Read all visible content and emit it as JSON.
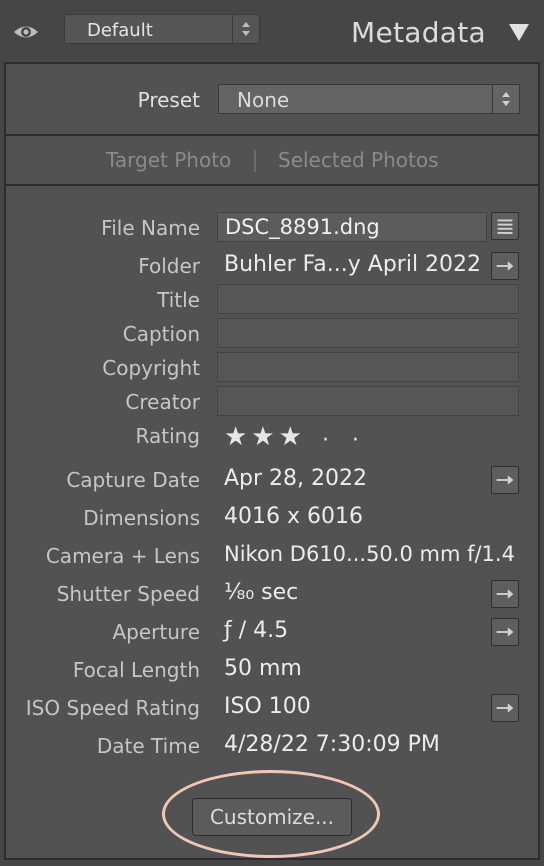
{
  "header": {
    "view_dropdown": "Default",
    "panel_title": "Metadata"
  },
  "preset": {
    "label": "Preset",
    "value": "None"
  },
  "target": {
    "target_photo": "Target Photo",
    "selected_photos": "Selected Photos"
  },
  "fields": {
    "file_name": {
      "label": "File Name",
      "value": "DSC_8891.dng"
    },
    "folder": {
      "label": "Folder",
      "value": "Buhler Fa...y April 2022"
    },
    "title": {
      "label": "Title",
      "value": ""
    },
    "caption": {
      "label": "Caption",
      "value": ""
    },
    "copyright": {
      "label": "Copyright",
      "value": ""
    },
    "creator": {
      "label": "Creator",
      "value": ""
    },
    "rating": {
      "label": "Rating",
      "filled_stars": 3,
      "total": 5,
      "stars_text": "★★★",
      "dot": "·"
    },
    "capture_date": {
      "label": "Capture Date",
      "value": "Apr 28, 2022"
    },
    "dimensions": {
      "label": "Dimensions",
      "value": "4016 x 6016"
    },
    "camera_lens": {
      "label": "Camera + Lens",
      "value": "Nikon D610...50.0 mm f/1.4"
    },
    "shutter_speed": {
      "label": "Shutter Speed",
      "value": "⅟₈₀ sec"
    },
    "aperture": {
      "label": "Aperture",
      "value": "ƒ / 4.5"
    },
    "focal_length": {
      "label": "Focal Length",
      "value": "50 mm"
    },
    "iso": {
      "label": "ISO Speed Rating",
      "value": "ISO 100"
    },
    "date_time": {
      "label": "Date Time",
      "value": "4/28/22 7:30:09 PM"
    }
  },
  "buttons": {
    "customize": "Customize..."
  },
  "icons": {
    "eye": "eye-icon",
    "collapse": "triangle-down-icon",
    "list": "list-icon",
    "go": "arrow-right-icon"
  },
  "colors": {
    "background": "#464646",
    "panel": "#525252",
    "highlight_ring": "#f1c6b6"
  }
}
